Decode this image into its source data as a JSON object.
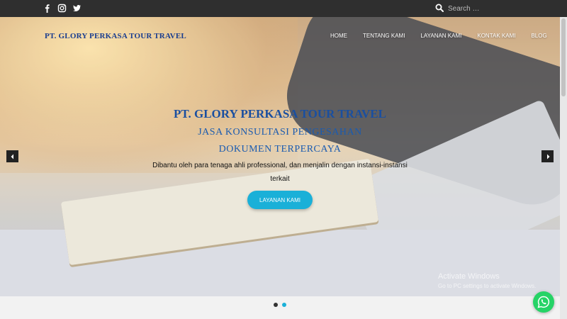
{
  "topbar": {
    "social_icons": [
      "facebook-icon",
      "instagram-icon",
      "twitter-icon"
    ],
    "search": {
      "placeholder": "Search …"
    }
  },
  "header": {
    "brand": "PT. GLORY PERKASA TOUR TRAVEL",
    "nav": [
      "HOME",
      "TENTANG KAMI",
      "LAYANAN KAMI",
      "KONTAK KAMI",
      "BLOG"
    ]
  },
  "hero": {
    "title": "PT. GLORY PERKASA TOUR TRAVEL",
    "subtitle_line1": "JASA KONSULTASI PENGESAHAN",
    "subtitle_line2": "DOKUMEN TERPERCAYA",
    "description": "Dibantu oleh para tenaga ahli professional, dan menjalin dengan instansi-instansi terkait",
    "cta_label": "LAYANAN KAMI"
  },
  "watermark": {
    "line1": "Activate Windows",
    "line2": "Go to PC settings to activate Windows."
  },
  "slider": {
    "dot_count": 2,
    "active_index": 1
  },
  "colors": {
    "accent": "#1ab0d8",
    "brand": "#1a3d8f",
    "topbar": "#2f2f2f",
    "whatsapp": "#25d366"
  }
}
